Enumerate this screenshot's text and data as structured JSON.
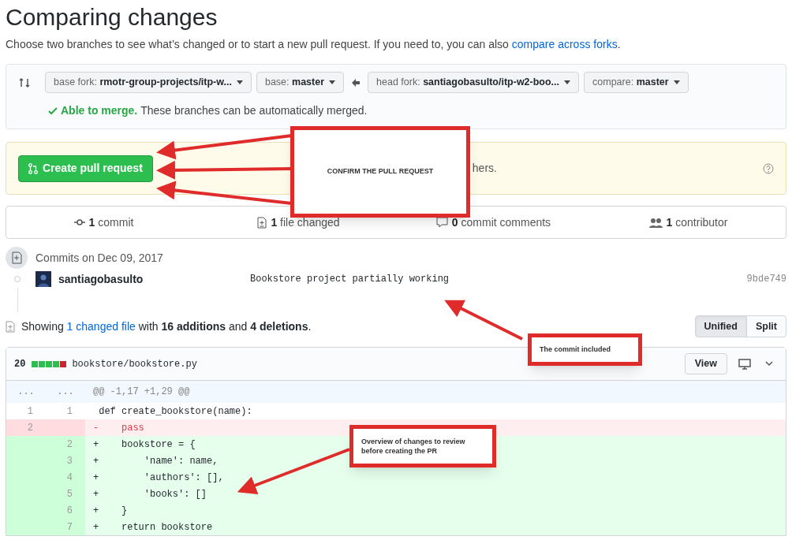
{
  "title": "Comparing changes",
  "subtitle": {
    "text": "Choose two branches to see what’s changed or to start a new pull request. If you need to, you can also",
    "link": "compare across forks",
    "end": "."
  },
  "selectors": [
    {
      "label": "base fork:",
      "value": "rmotr-group-projects/itp-w..."
    },
    {
      "label": "base:",
      "value": "master"
    },
    {
      "label": "head fork:",
      "value": "santiagobasulto/itp-w2-boo..."
    },
    {
      "label": "compare:",
      "value": "master"
    }
  ],
  "merge_status": {
    "title": "Able to merge.",
    "text": "These branches can be automatically merged."
  },
  "create_button": "Create pull request",
  "create_hint": "hers.",
  "stats": [
    {
      "kind": "commit",
      "count": "1",
      "label": "commit"
    },
    {
      "kind": "file",
      "count": "1",
      "label": "file changed"
    },
    {
      "kind": "comment",
      "count": "0",
      "label": "commit comments"
    },
    {
      "kind": "people",
      "count": "1",
      "label": "contributor"
    }
  ],
  "commits_heading": "Commits on Dec 09, 2017",
  "commits": [
    {
      "author": "santiagobasulto",
      "message": "Bookstore project partially working",
      "sha": "9bde749"
    }
  ],
  "summary": {
    "prefix": "Showing",
    "link": "1 changed file",
    "rest": "with **16 additions** and **4 deletions**."
  },
  "view_modes": [
    {
      "label": "Unified",
      "selected": true
    },
    {
      "label": "Split",
      "selected": false
    }
  ],
  "file": {
    "changes": "20",
    "diffstat": [
      {
        "color": "#2cbe4e"
      },
      {
        "color": "#2cbe4e"
      },
      {
        "color": "#2cbe4e"
      },
      {
        "color": "#2cbe4e"
      },
      {
        "color": "#cb2431"
      }
    ],
    "path": "bookstore/bookstore.py",
    "view_button": "View",
    "hunk": {
      "old": "...",
      "new": "...",
      "header": "@@ -1,17 +1,29 @@"
    },
    "lines": [
      {
        "kind": "context",
        "old": "1",
        "new": "1",
        "code": " def create_bookstore(name):"
      },
      {
        "kind": "deletion",
        "old": "2",
        "code": "-    pass"
      },
      {
        "kind": "addition",
        "new": "2",
        "code": "+    bookstore = {"
      },
      {
        "kind": "addition",
        "new": "3",
        "code": "+        'name': name,"
      },
      {
        "kind": "addition",
        "new": "4",
        "code": "+        'authors': [],"
      },
      {
        "kind": "addition",
        "new": "5",
        "code": "+        'books': []"
      },
      {
        "kind": "addition",
        "new": "6",
        "code": "+    }"
      },
      {
        "kind": "addition",
        "new": "7",
        "code": "+    return bookstore"
      }
    ]
  },
  "annotations": [
    {
      "text": "CONFIRM THE PULL REQUEST"
    },
    {
      "text": "The commit included"
    },
    {
      "text": "Overview of changes to review before creating the PR"
    }
  ]
}
